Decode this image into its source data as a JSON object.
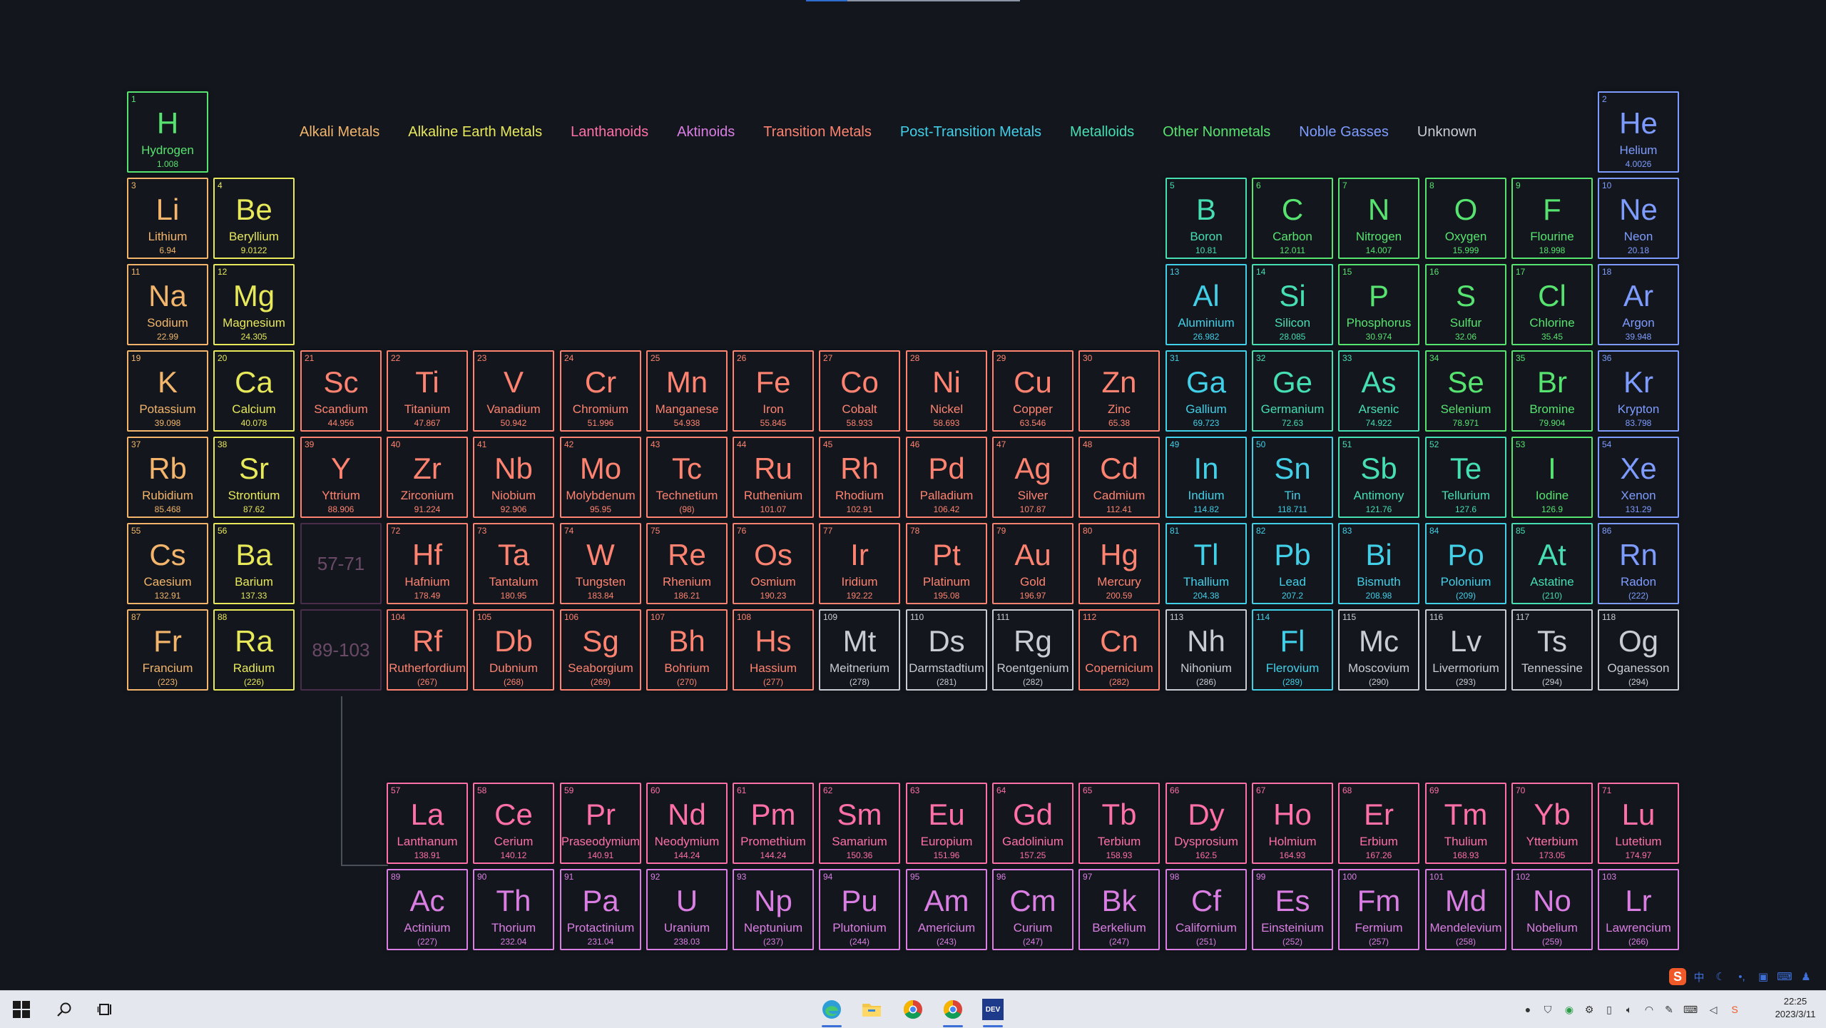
{
  "colors": {
    "alkali": "#f2b56b",
    "alkaline": "#e7e85a",
    "transition": "#ff8370",
    "post_transition": "#42cfe8",
    "metalloid": "#46dfb2",
    "nonmetal": "#57e36f",
    "noble": "#7e9cff",
    "lanthanoid": "#ff6fa8",
    "actinoid": "#da7ee3",
    "unknown": "#c9cdd3"
  },
  "legend": [
    {
      "label": "Alkali Metals",
      "cat": "alkali"
    },
    {
      "label": "Alkaline Earth Metals",
      "cat": "alkaline"
    },
    {
      "label": "Lanthanoids",
      "cat": "lanthanoid"
    },
    {
      "label": "Aktinoids",
      "cat": "actinoid"
    },
    {
      "label": "Transition Metals",
      "cat": "transition"
    },
    {
      "label": "Post-Transition Metals",
      "cat": "post_transition"
    },
    {
      "label": "Metalloids",
      "cat": "metalloid"
    },
    {
      "label": "Other Nonmetals",
      "cat": "nonmetal"
    },
    {
      "label": "Noble Gasses",
      "cat": "noble"
    },
    {
      "label": "Unknown",
      "cat": "unknown"
    }
  ],
  "placeholders": [
    {
      "label": "57-71",
      "row": 6,
      "col": 3
    },
    {
      "label": "89-103",
      "row": 7,
      "col": 3
    }
  ],
  "elements": [
    {
      "n": "1",
      "s": "H",
      "name": "Hydrogen",
      "m": "1.008",
      "row": 1,
      "col": 1,
      "cat": "nonmetal"
    },
    {
      "n": "2",
      "s": "He",
      "name": "Helium",
      "m": "4.0026",
      "row": 1,
      "col": 18,
      "cat": "noble"
    },
    {
      "n": "3",
      "s": "Li",
      "name": "Lithium",
      "m": "6.94",
      "row": 2,
      "col": 1,
      "cat": "alkali"
    },
    {
      "n": "4",
      "s": "Be",
      "name": "Beryllium",
      "m": "9.0122",
      "row": 2,
      "col": 2,
      "cat": "alkaline"
    },
    {
      "n": "5",
      "s": "B",
      "name": "Boron",
      "m": "10.81",
      "row": 2,
      "col": 13,
      "cat": "metalloid"
    },
    {
      "n": "6",
      "s": "C",
      "name": "Carbon",
      "m": "12.011",
      "row": 2,
      "col": 14,
      "cat": "nonmetal"
    },
    {
      "n": "7",
      "s": "N",
      "name": "Nitrogen",
      "m": "14.007",
      "row": 2,
      "col": 15,
      "cat": "nonmetal"
    },
    {
      "n": "8",
      "s": "O",
      "name": "Oxygen",
      "m": "15.999",
      "row": 2,
      "col": 16,
      "cat": "nonmetal"
    },
    {
      "n": "9",
      "s": "F",
      "name": "Flourine",
      "m": "18.998",
      "row": 2,
      "col": 17,
      "cat": "nonmetal"
    },
    {
      "n": "10",
      "s": "Ne",
      "name": "Neon",
      "m": "20.18",
      "row": 2,
      "col": 18,
      "cat": "noble"
    },
    {
      "n": "11",
      "s": "Na",
      "name": "Sodium",
      "m": "22.99",
      "row": 3,
      "col": 1,
      "cat": "alkali"
    },
    {
      "n": "12",
      "s": "Mg",
      "name": "Magnesium",
      "m": "24.305",
      "row": 3,
      "col": 2,
      "cat": "alkaline"
    },
    {
      "n": "13",
      "s": "Al",
      "name": "Aluminium",
      "m": "26.982",
      "row": 3,
      "col": 13,
      "cat": "post_transition"
    },
    {
      "n": "14",
      "s": "Si",
      "name": "Silicon",
      "m": "28.085",
      "row": 3,
      "col": 14,
      "cat": "metalloid"
    },
    {
      "n": "15",
      "s": "P",
      "name": "Phosphorus",
      "m": "30.974",
      "row": 3,
      "col": 15,
      "cat": "nonmetal"
    },
    {
      "n": "16",
      "s": "S",
      "name": "Sulfur",
      "m": "32.06",
      "row": 3,
      "col": 16,
      "cat": "nonmetal"
    },
    {
      "n": "17",
      "s": "Cl",
      "name": "Chlorine",
      "m": "35.45",
      "row": 3,
      "col": 17,
      "cat": "nonmetal"
    },
    {
      "n": "18",
      "s": "Ar",
      "name": "Argon",
      "m": "39.948",
      "row": 3,
      "col": 18,
      "cat": "noble"
    },
    {
      "n": "19",
      "s": "K",
      "name": "Potassium",
      "m": "39.098",
      "row": 4,
      "col": 1,
      "cat": "alkali"
    },
    {
      "n": "20",
      "s": "Ca",
      "name": "Calcium",
      "m": "40.078",
      "row": 4,
      "col": 2,
      "cat": "alkaline"
    },
    {
      "n": "21",
      "s": "Sc",
      "name": "Scandium",
      "m": "44.956",
      "row": 4,
      "col": 3,
      "cat": "transition"
    },
    {
      "n": "22",
      "s": "Ti",
      "name": "Titanium",
      "m": "47.867",
      "row": 4,
      "col": 4,
      "cat": "transition"
    },
    {
      "n": "23",
      "s": "V",
      "name": "Vanadium",
      "m": "50.942",
      "row": 4,
      "col": 5,
      "cat": "transition"
    },
    {
      "n": "24",
      "s": "Cr",
      "name": "Chromium",
      "m": "51.996",
      "row": 4,
      "col": 6,
      "cat": "transition"
    },
    {
      "n": "25",
      "s": "Mn",
      "name": "Manganese",
      "m": "54.938",
      "row": 4,
      "col": 7,
      "cat": "transition"
    },
    {
      "n": "26",
      "s": "Fe",
      "name": "Iron",
      "m": "55.845",
      "row": 4,
      "col": 8,
      "cat": "transition"
    },
    {
      "n": "27",
      "s": "Co",
      "name": "Cobalt",
      "m": "58.933",
      "row": 4,
      "col": 9,
      "cat": "transition"
    },
    {
      "n": "28",
      "s": "Ni",
      "name": "Nickel",
      "m": "58.693",
      "row": 4,
      "col": 10,
      "cat": "transition"
    },
    {
      "n": "29",
      "s": "Cu",
      "name": "Copper",
      "m": "63.546",
      "row": 4,
      "col": 11,
      "cat": "transition"
    },
    {
      "n": "30",
      "s": "Zn",
      "name": "Zinc",
      "m": "65.38",
      "row": 4,
      "col": 12,
      "cat": "transition"
    },
    {
      "n": "31",
      "s": "Ga",
      "name": "Gallium",
      "m": "69.723",
      "row": 4,
      "col": 13,
      "cat": "post_transition"
    },
    {
      "n": "32",
      "s": "Ge",
      "name": "Germanium",
      "m": "72.63",
      "row": 4,
      "col": 14,
      "cat": "metalloid"
    },
    {
      "n": "33",
      "s": "As",
      "name": "Arsenic",
      "m": "74.922",
      "row": 4,
      "col": 15,
      "cat": "metalloid"
    },
    {
      "n": "34",
      "s": "Se",
      "name": "Selenium",
      "m": "78.971",
      "row": 4,
      "col": 16,
      "cat": "nonmetal"
    },
    {
      "n": "35",
      "s": "Br",
      "name": "Bromine",
      "m": "79.904",
      "row": 4,
      "col": 17,
      "cat": "nonmetal"
    },
    {
      "n": "36",
      "s": "Kr",
      "name": "Krypton",
      "m": "83.798",
      "row": 4,
      "col": 18,
      "cat": "noble"
    },
    {
      "n": "37",
      "s": "Rb",
      "name": "Rubidium",
      "m": "85.468",
      "row": 5,
      "col": 1,
      "cat": "alkali"
    },
    {
      "n": "38",
      "s": "Sr",
      "name": "Strontium",
      "m": "87.62",
      "row": 5,
      "col": 2,
      "cat": "alkaline"
    },
    {
      "n": "39",
      "s": "Y",
      "name": "Yttrium",
      "m": "88.906",
      "row": 5,
      "col": 3,
      "cat": "transition"
    },
    {
      "n": "40",
      "s": "Zr",
      "name": "Zirconium",
      "m": "91.224",
      "row": 5,
      "col": 4,
      "cat": "transition"
    },
    {
      "n": "41",
      "s": "Nb",
      "name": "Niobium",
      "m": "92.906",
      "row": 5,
      "col": 5,
      "cat": "transition"
    },
    {
      "n": "42",
      "s": "Mo",
      "name": "Molybdenum",
      "m": "95.95",
      "row": 5,
      "col": 6,
      "cat": "transition"
    },
    {
      "n": "43",
      "s": "Tc",
      "name": "Technetium",
      "m": "(98)",
      "row": 5,
      "col": 7,
      "cat": "transition"
    },
    {
      "n": "44",
      "s": "Ru",
      "name": "Ruthenium",
      "m": "101.07",
      "row": 5,
      "col": 8,
      "cat": "transition"
    },
    {
      "n": "45",
      "s": "Rh",
      "name": "Rhodium",
      "m": "102.91",
      "row": 5,
      "col": 9,
      "cat": "transition"
    },
    {
      "n": "46",
      "s": "Pd",
      "name": "Palladium",
      "m": "106.42",
      "row": 5,
      "col": 10,
      "cat": "transition"
    },
    {
      "n": "47",
      "s": "Ag",
      "name": "Silver",
      "m": "107.87",
      "row": 5,
      "col": 11,
      "cat": "transition"
    },
    {
      "n": "48",
      "s": "Cd",
      "name": "Cadmium",
      "m": "112.41",
      "row": 5,
      "col": 12,
      "cat": "transition"
    },
    {
      "n": "49",
      "s": "In",
      "name": "Indium",
      "m": "114.82",
      "row": 5,
      "col": 13,
      "cat": "post_transition"
    },
    {
      "n": "50",
      "s": "Sn",
      "name": "Tin",
      "m": "118.711",
      "row": 5,
      "col": 14,
      "cat": "post_transition"
    },
    {
      "n": "51",
      "s": "Sb",
      "name": "Antimony",
      "m": "121.76",
      "row": 5,
      "col": 15,
      "cat": "metalloid"
    },
    {
      "n": "52",
      "s": "Te",
      "name": "Tellurium",
      "m": "127.6",
      "row": 5,
      "col": 16,
      "cat": "metalloid"
    },
    {
      "n": "53",
      "s": "I",
      "name": "Iodine",
      "m": "126.9",
      "row": 5,
      "col": 17,
      "cat": "nonmetal"
    },
    {
      "n": "54",
      "s": "Xe",
      "name": "Xenon",
      "m": "131.29",
      "row": 5,
      "col": 18,
      "cat": "noble"
    },
    {
      "n": "55",
      "s": "Cs",
      "name": "Caesium",
      "m": "132.91",
      "row": 6,
      "col": 1,
      "cat": "alkali"
    },
    {
      "n": "56",
      "s": "Ba",
      "name": "Barium",
      "m": "137.33",
      "row": 6,
      "col": 2,
      "cat": "alkaline"
    },
    {
      "n": "72",
      "s": "Hf",
      "name": "Hafnium",
      "m": "178.49",
      "row": 6,
      "col": 4,
      "cat": "transition"
    },
    {
      "n": "73",
      "s": "Ta",
      "name": "Tantalum",
      "m": "180.95",
      "row": 6,
      "col": 5,
      "cat": "transition"
    },
    {
      "n": "74",
      "s": "W",
      "name": "Tungsten",
      "m": "183.84",
      "row": 6,
      "col": 6,
      "cat": "transition"
    },
    {
      "n": "75",
      "s": "Re",
      "name": "Rhenium",
      "m": "186.21",
      "row": 6,
      "col": 7,
      "cat": "transition"
    },
    {
      "n": "76",
      "s": "Os",
      "name": "Osmium",
      "m": "190.23",
      "row": 6,
      "col": 8,
      "cat": "transition"
    },
    {
      "n": "77",
      "s": "Ir",
      "name": "Iridium",
      "m": "192.22",
      "row": 6,
      "col": 9,
      "cat": "transition"
    },
    {
      "n": "78",
      "s": "Pt",
      "name": "Platinum",
      "m": "195.08",
      "row": 6,
      "col": 10,
      "cat": "transition"
    },
    {
      "n": "79",
      "s": "Au",
      "name": "Gold",
      "m": "196.97",
      "row": 6,
      "col": 11,
      "cat": "transition"
    },
    {
      "n": "80",
      "s": "Hg",
      "name": "Mercury",
      "m": "200.59",
      "row": 6,
      "col": 12,
      "cat": "transition"
    },
    {
      "n": "81",
      "s": "Tl",
      "name": "Thallium",
      "m": "204.38",
      "row": 6,
      "col": 13,
      "cat": "post_transition"
    },
    {
      "n": "82",
      "s": "Pb",
      "name": "Lead",
      "m": "207.2",
      "row": 6,
      "col": 14,
      "cat": "post_transition"
    },
    {
      "n": "83",
      "s": "Bi",
      "name": "Bismuth",
      "m": "208.98",
      "row": 6,
      "col": 15,
      "cat": "post_transition"
    },
    {
      "n": "84",
      "s": "Po",
      "name": "Polonium",
      "m": "(209)",
      "row": 6,
      "col": 16,
      "cat": "post_transition"
    },
    {
      "n": "85",
      "s": "At",
      "name": "Astatine",
      "m": "(210)",
      "row": 6,
      "col": 17,
      "cat": "metalloid"
    },
    {
      "n": "86",
      "s": "Rn",
      "name": "Radon",
      "m": "(222)",
      "row": 6,
      "col": 18,
      "cat": "noble"
    },
    {
      "n": "87",
      "s": "Fr",
      "name": "Francium",
      "m": "(223)",
      "row": 7,
      "col": 1,
      "cat": "alkali"
    },
    {
      "n": "88",
      "s": "Ra",
      "name": "Radium",
      "m": "(226)",
      "row": 7,
      "col": 2,
      "cat": "alkaline"
    },
    {
      "n": "104",
      "s": "Rf",
      "name": "Rutherfordium",
      "m": "(267)",
      "row": 7,
      "col": 4,
      "cat": "transition"
    },
    {
      "n": "105",
      "s": "Db",
      "name": "Dubnium",
      "m": "(268)",
      "row": 7,
      "col": 5,
      "cat": "transition"
    },
    {
      "n": "106",
      "s": "Sg",
      "name": "Seaborgium",
      "m": "(269)",
      "row": 7,
      "col": 6,
      "cat": "transition"
    },
    {
      "n": "107",
      "s": "Bh",
      "name": "Bohrium",
      "m": "(270)",
      "row": 7,
      "col": 7,
      "cat": "transition"
    },
    {
      "n": "108",
      "s": "Hs",
      "name": "Hassium",
      "m": "(277)",
      "row": 7,
      "col": 8,
      "cat": "transition"
    },
    {
      "n": "109",
      "s": "Mt",
      "name": "Meitnerium",
      "m": "(278)",
      "row": 7,
      "col": 9,
      "cat": "unknown"
    },
    {
      "n": "110",
      "s": "Ds",
      "name": "Darmstadtium",
      "m": "(281)",
      "row": 7,
      "col": 10,
      "cat": "unknown"
    },
    {
      "n": "111",
      "s": "Rg",
      "name": "Roentgenium",
      "m": "(282)",
      "row": 7,
      "col": 11,
      "cat": "unknown"
    },
    {
      "n": "112",
      "s": "Cn",
      "name": "Copernicium",
      "m": "(282)",
      "row": 7,
      "col": 12,
      "cat": "transition"
    },
    {
      "n": "113",
      "s": "Nh",
      "name": "Nihonium",
      "m": "(286)",
      "row": 7,
      "col": 13,
      "cat": "unknown"
    },
    {
      "n": "114",
      "s": "Fl",
      "name": "Flerovium",
      "m": "(289)",
      "row": 7,
      "col": 14,
      "cat": "post_transition"
    },
    {
      "n": "115",
      "s": "Mc",
      "name": "Moscovium",
      "m": "(290)",
      "row": 7,
      "col": 15,
      "cat": "unknown"
    },
    {
      "n": "116",
      "s": "Lv",
      "name": "Livermorium",
      "m": "(293)",
      "row": 7,
      "col": 16,
      "cat": "unknown"
    },
    {
      "n": "117",
      "s": "Ts",
      "name": "Tennessine",
      "m": "(294)",
      "row": 7,
      "col": 17,
      "cat": "unknown"
    },
    {
      "n": "118",
      "s": "Og",
      "name": "Oganesson",
      "m": "(294)",
      "row": 7,
      "col": 18,
      "cat": "unknown"
    },
    {
      "n": "57",
      "s": "La",
      "name": "Lanthanum",
      "m": "138.91",
      "row": 9,
      "col": 4,
      "cat": "lanthanoid"
    },
    {
      "n": "58",
      "s": "Ce",
      "name": "Cerium",
      "m": "140.12",
      "row": 9,
      "col": 5,
      "cat": "lanthanoid"
    },
    {
      "n": "59",
      "s": "Pr",
      "name": "Praseodymium",
      "m": "140.91",
      "row": 9,
      "col": 6,
      "cat": "lanthanoid"
    },
    {
      "n": "60",
      "s": "Nd",
      "name": "Neodymium",
      "m": "144.24",
      "row": 9,
      "col": 7,
      "cat": "lanthanoid"
    },
    {
      "n": "61",
      "s": "Pm",
      "name": "Promethium",
      "m": "144.24",
      "row": 9,
      "col": 8,
      "cat": "lanthanoid"
    },
    {
      "n": "62",
      "s": "Sm",
      "name": "Samarium",
      "m": "150.36",
      "row": 9,
      "col": 9,
      "cat": "lanthanoid"
    },
    {
      "n": "63",
      "s": "Eu",
      "name": "Europium",
      "m": "151.96",
      "row": 9,
      "col": 10,
      "cat": "lanthanoid"
    },
    {
      "n": "64",
      "s": "Gd",
      "name": "Gadolinium",
      "m": "157.25",
      "row": 9,
      "col": 11,
      "cat": "lanthanoid"
    },
    {
      "n": "65",
      "s": "Tb",
      "name": "Terbium",
      "m": "158.93",
      "row": 9,
      "col": 12,
      "cat": "lanthanoid"
    },
    {
      "n": "66",
      "s": "Dy",
      "name": "Dysprosium",
      "m": "162.5",
      "row": 9,
      "col": 13,
      "cat": "lanthanoid"
    },
    {
      "n": "67",
      "s": "Ho",
      "name": "Holmium",
      "m": "164.93",
      "row": 9,
      "col": 14,
      "cat": "lanthanoid"
    },
    {
      "n": "68",
      "s": "Er",
      "name": "Erbium",
      "m": "167.26",
      "row": 9,
      "col": 15,
      "cat": "lanthanoid"
    },
    {
      "n": "69",
      "s": "Tm",
      "name": "Thulium",
      "m": "168.93",
      "row": 9,
      "col": 16,
      "cat": "lanthanoid"
    },
    {
      "n": "70",
      "s": "Yb",
      "name": "Ytterbium",
      "m": "173.05",
      "row": 9,
      "col": 17,
      "cat": "lanthanoid"
    },
    {
      "n": "71",
      "s": "Lu",
      "name": "Lutetium",
      "m": "174.97",
      "row": 9,
      "col": 18,
      "cat": "lanthanoid"
    },
    {
      "n": "89",
      "s": "Ac",
      "name": "Actinium",
      "m": "(227)",
      "row": 10,
      "col": 4,
      "cat": "actinoid"
    },
    {
      "n": "90",
      "s": "Th",
      "name": "Thorium",
      "m": "232.04",
      "row": 10,
      "col": 5,
      "cat": "actinoid"
    },
    {
      "n": "91",
      "s": "Pa",
      "name": "Protactinium",
      "m": "231.04",
      "row": 10,
      "col": 6,
      "cat": "actinoid"
    },
    {
      "n": "92",
      "s": "U",
      "name": "Uranium",
      "m": "238.03",
      "row": 10,
      "col": 7,
      "cat": "actinoid"
    },
    {
      "n": "93",
      "s": "Np",
      "name": "Neptunium",
      "m": "(237)",
      "row": 10,
      "col": 8,
      "cat": "actinoid"
    },
    {
      "n": "94",
      "s": "Pu",
      "name": "Plutonium",
      "m": "(244)",
      "row": 10,
      "col": 9,
      "cat": "actinoid"
    },
    {
      "n": "95",
      "s": "Am",
      "name": "Americium",
      "m": "(243)",
      "row": 10,
      "col": 10,
      "cat": "actinoid"
    },
    {
      "n": "96",
      "s": "Cm",
      "name": "Curium",
      "m": "(247)",
      "row": 10,
      "col": 11,
      "cat": "actinoid"
    },
    {
      "n": "97",
      "s": "Bk",
      "name": "Berkelium",
      "m": "(247)",
      "row": 10,
      "col": 12,
      "cat": "actinoid"
    },
    {
      "n": "98",
      "s": "Cf",
      "name": "Californium",
      "m": "(251)",
      "row": 10,
      "col": 13,
      "cat": "actinoid"
    },
    {
      "n": "99",
      "s": "Es",
      "name": "Einsteinium",
      "m": "(252)",
      "row": 10,
      "col": 14,
      "cat": "actinoid"
    },
    {
      "n": "100",
      "s": "Fm",
      "name": "Fermium",
      "m": "(257)",
      "row": 10,
      "col": 15,
      "cat": "actinoid"
    },
    {
      "n": "101",
      "s": "Md",
      "name": "Mendelevium",
      "m": "(258)",
      "row": 10,
      "col": 16,
      "cat": "actinoid"
    },
    {
      "n": "102",
      "s": "No",
      "name": "Nobelium",
      "m": "(259)",
      "row": 10,
      "col": 17,
      "cat": "actinoid"
    },
    {
      "n": "103",
      "s": "Lr",
      "name": "Lawrencium",
      "m": "(266)",
      "row": 10,
      "col": 18,
      "cat": "actinoid"
    }
  ],
  "taskbar": {
    "apps": [
      {
        "name": "start-button",
        "icon": "windows-icon"
      },
      {
        "name": "search-button",
        "icon": "search-icon"
      },
      {
        "name": "task-view-button",
        "icon": "task-view-icon"
      },
      {
        "name": "taskbar-app-edge",
        "icon": "edge-icon"
      },
      {
        "name": "taskbar-app-explorer",
        "icon": "folder-icon"
      },
      {
        "name": "taskbar-app-chrome",
        "icon": "chrome-icon"
      },
      {
        "name": "taskbar-app-chrome-2",
        "icon": "chrome-icon"
      },
      {
        "name": "taskbar-app-dev",
        "icon": "dev-icon"
      }
    ],
    "dev_label": "DEV",
    "ime_label": "中",
    "sogou_label": "S",
    "clock_time": "22:25",
    "clock_date": "2023/3/11"
  }
}
